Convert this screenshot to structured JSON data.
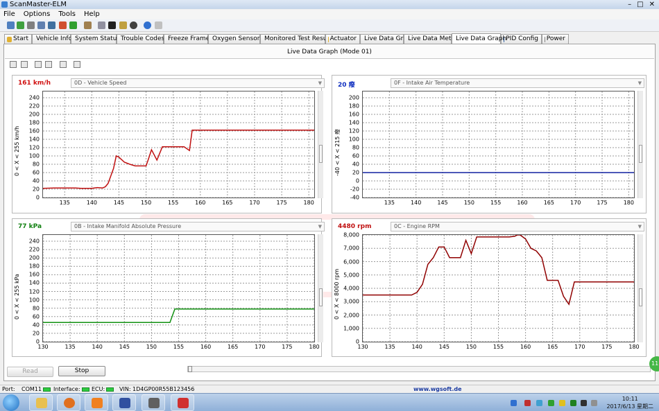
{
  "window": {
    "title": "ScanMaster-ELM",
    "controls": [
      "–",
      "□",
      "✕"
    ]
  },
  "menu": [
    "File",
    "Options",
    "Tools",
    "Help"
  ],
  "tabs": [
    {
      "label": "Start",
      "color": "#e0b030"
    },
    {
      "label": "Vehicle Info",
      "color": "#5070c0"
    },
    {
      "label": "System Status",
      "color": "#a06020"
    },
    {
      "label": "Trouble Codes",
      "color": "#e06010"
    },
    {
      "label": "Freeze Frames",
      "color": "#e0b030"
    },
    {
      "label": "Oxygen Sensors",
      "color": "#30a030"
    },
    {
      "label": "Monitored Test Results",
      "color": "#8080a0"
    },
    {
      "label": "Actuator",
      "color": "#e0b030"
    },
    {
      "label": "Live Data Grid",
      "color": "#3080a0"
    },
    {
      "label": "Live Data Meter",
      "color": "#6060a0"
    },
    {
      "label": "Live Data Graph",
      "color": "#3080a0",
      "active": true
    },
    {
      "label": "PID Config",
      "color": "#3060a0"
    },
    {
      "label": "Power",
      "color": "#808080"
    }
  ],
  "main": {
    "header": "Live Data Graph (Mode 01)"
  },
  "graphs": [
    {
      "value": "161 km/h",
      "value_color": "#d01010",
      "pid": "0D - Vehicle Speed",
      "yname": "0  < X <  255  km/h",
      "line_color": "#c01010"
    },
    {
      "value": "20 癈",
      "value_color": "#1030c0",
      "pid": "0F - Intake Air Temperature",
      "yname": "-40  < X <  215  癈",
      "line_color": "#1020a0"
    },
    {
      "value": "77 kPa",
      "value_color": "#108010",
      "pid": "0B - Intake Manifold Absolute Pressure",
      "yname": "0  < X <  255  kPa",
      "line_color": "#109010"
    },
    {
      "value": "4480 rpm",
      "value_color": "#c01010",
      "pid": "0C - Engine RPM",
      "yname": "0  < X <  8000  rpm",
      "line_color": "#900000"
    }
  ],
  "chart_data": [
    {
      "type": "line",
      "title": "0D - Vehicle Speed",
      "ylabel": "km/h",
      "xlim": [
        131,
        181
      ],
      "ylim": [
        0,
        255
      ],
      "yticks": [
        0,
        20,
        40,
        60,
        80,
        100,
        120,
        140,
        160,
        180,
        200,
        220,
        240
      ],
      "xticks": [
        135,
        140,
        145,
        150,
        155,
        160,
        165,
        170,
        175,
        180
      ],
      "series": [
        {
          "x": [
            131,
            133,
            135,
            136,
            137,
            138,
            139,
            140,
            141,
            142,
            142.5,
            143,
            144,
            144.5,
            145,
            146,
            147,
            148,
            149,
            150,
            150.5,
            151,
            152,
            153,
            155,
            156,
            157,
            158,
            158.5,
            181
          ],
          "y": [
            22,
            23,
            23,
            23,
            23,
            22,
            22,
            22,
            24,
            23,
            26,
            34,
            70,
            100,
            97,
            85,
            80,
            76,
            76,
            76,
            95,
            115,
            90,
            122,
            122,
            122,
            122,
            113,
            162,
            162
          ]
        }
      ]
    },
    {
      "type": "line",
      "title": "0F - Intake Air Temperature",
      "ylabel": "癈",
      "xlim": [
        130,
        181
      ],
      "ylim": [
        -40,
        215
      ],
      "yticks": [
        -40,
        -20,
        0,
        20,
        40,
        60,
        80,
        100,
        120,
        140,
        160,
        180,
        200
      ],
      "xticks": [
        135,
        140,
        145,
        150,
        155,
        160,
        165,
        170,
        175,
        180
      ],
      "series": [
        {
          "x": [
            130,
            181
          ],
          "y": [
            20,
            20
          ]
        }
      ]
    },
    {
      "type": "line",
      "title": "0B - Intake Manifold Absolute Pressure",
      "ylabel": "kPa",
      "xlim": [
        130,
        180
      ],
      "ylim": [
        0,
        255
      ],
      "yticks": [
        0,
        20,
        40,
        60,
        80,
        100,
        120,
        140,
        160,
        180,
        200,
        220,
        240
      ],
      "xticks": [
        130,
        135,
        140,
        145,
        150,
        155,
        160,
        165,
        170,
        175,
        180
      ],
      "series": [
        {
          "x": [
            130,
            153.4,
            154.3,
            180
          ],
          "y": [
            46,
            46,
            78,
            78
          ]
        }
      ]
    },
    {
      "type": "line",
      "title": "0C - Engine RPM",
      "ylabel": "rpm",
      "xlim": [
        130,
        180
      ],
      "ylim": [
        0,
        8000
      ],
      "yticks": [
        0,
        1000,
        2000,
        3000,
        4000,
        5000,
        6000,
        7000,
        8000
      ],
      "xticks": [
        130,
        135,
        140,
        145,
        150,
        155,
        160,
        165,
        170,
        175,
        180
      ],
      "series": [
        {
          "x": [
            130,
            139,
            140,
            141,
            142,
            143,
            144,
            145,
            146,
            147,
            148,
            149,
            150,
            151,
            152,
            153,
            154,
            155,
            156,
            157,
            158,
            158.5,
            159,
            160,
            161,
            162,
            163,
            164,
            165,
            166,
            167,
            168,
            169,
            180
          ],
          "y": [
            3500,
            3500,
            3700,
            4300,
            5800,
            6300,
            7100,
            7100,
            6300,
            6300,
            6300,
            7600,
            6600,
            7850,
            7850,
            7850,
            7850,
            7850,
            7850,
            7850,
            7900,
            8200,
            8050,
            7700,
            7000,
            6800,
            6300,
            4600,
            4600,
            4600,
            3400,
            2800,
            4480,
            4480
          ]
        }
      ]
    }
  ],
  "buttons": {
    "read": "Read",
    "stop": "Stop"
  },
  "status": {
    "port_label": "Port:",
    "port": "COM11",
    "interface_label": "Interface:",
    "ecu_label": "ECU:",
    "vin": "VIN: 1D4GP00R55B123456",
    "website": "www.wgsoft.de"
  },
  "clock": {
    "time": "10:11",
    "date": "2017/6/13 星期二"
  },
  "side_badge": "11"
}
